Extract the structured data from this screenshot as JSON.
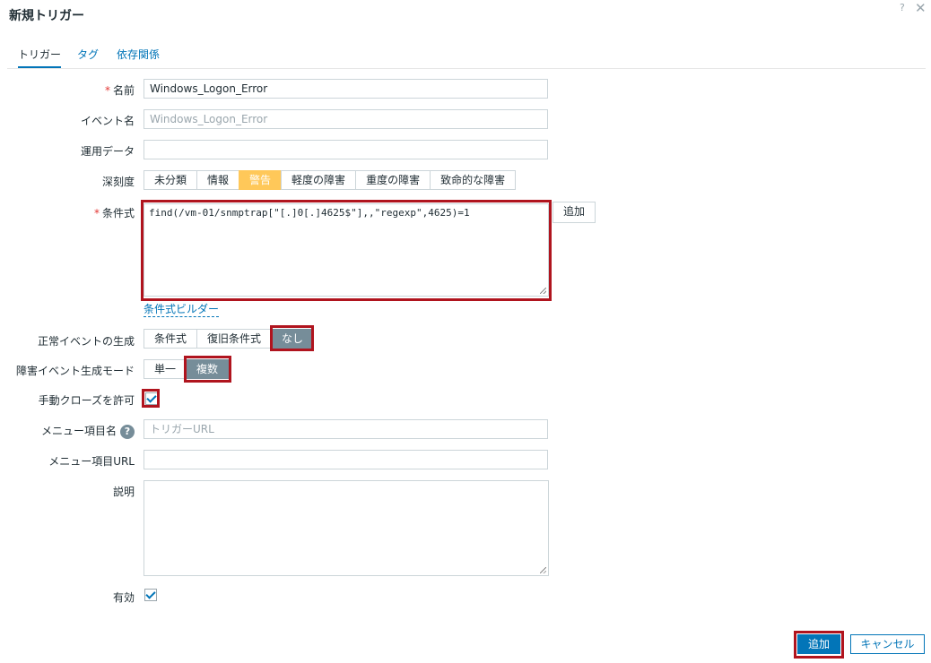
{
  "dialog": {
    "title": "新規トリガー",
    "help_glyph": "?",
    "close_glyph": "✕"
  },
  "tabs": [
    {
      "label": "トリガー",
      "active": true
    },
    {
      "label": "タグ",
      "active": false
    },
    {
      "label": "依存関係",
      "active": false
    }
  ],
  "form": {
    "name": {
      "label": "名前",
      "value": "Windows_Logon_Error"
    },
    "event_name": {
      "label": "イベント名",
      "placeholder": "Windows_Logon_Error"
    },
    "opdata": {
      "label": "運用データ",
      "value": ""
    },
    "severity": {
      "label": "深刻度",
      "options": [
        "未分類",
        "情報",
        "警告",
        "軽度の障害",
        "重度の障害",
        "致命的な障害"
      ],
      "selected": "警告"
    },
    "expression": {
      "label": "条件式",
      "value": "find(/vm-01/snmptrap[\"[.]0[.]4625$\"],,\"regexp\",4625)=1",
      "add_button": "追加",
      "builder_link": "条件式ビルダー"
    },
    "ok_event": {
      "label": "正常イベントの生成",
      "options": [
        "条件式",
        "復旧条件式",
        "なし"
      ],
      "selected": "なし"
    },
    "problem_mode": {
      "label": "障害イベント生成モード",
      "options": [
        "単一",
        "複数"
      ],
      "selected": "複数"
    },
    "manual_close": {
      "label": "手動クローズを許可",
      "checked": true
    },
    "url_name": {
      "label": "メニュー項目名",
      "placeholder": "トリガーURL",
      "help_glyph": "?"
    },
    "url": {
      "label": "メニュー項目URL",
      "value": ""
    },
    "description": {
      "label": "説明",
      "value": ""
    },
    "enabled": {
      "label": "有効",
      "checked": true
    }
  },
  "footer": {
    "add_label": "追加",
    "cancel_label": "キャンセル"
  },
  "colors": {
    "accent": "#0275b8",
    "warning": "#ffc859",
    "selected": "#768d99",
    "highlight": "#b0141e"
  }
}
